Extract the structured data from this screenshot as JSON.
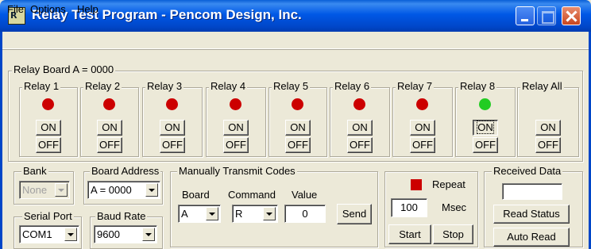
{
  "window": {
    "title": "Relay Test Program - Pencom Design, Inc.",
    "app_icon_text": "R"
  },
  "menu": [
    "File",
    "Options",
    "Help"
  ],
  "relay_board": {
    "title": "Relay Board A = 0000",
    "relays": [
      {
        "label": "Relay 1",
        "led_color": "#cc0000",
        "on": "ON",
        "off": "OFF"
      },
      {
        "label": "Relay 2",
        "led_color": "#cc0000",
        "on": "ON",
        "off": "OFF"
      },
      {
        "label": "Relay 3",
        "led_color": "#cc0000",
        "on": "ON",
        "off": "OFF"
      },
      {
        "label": "Relay 4",
        "led_color": "#cc0000",
        "on": "ON",
        "off": "OFF"
      },
      {
        "label": "Relay 5",
        "led_color": "#cc0000",
        "on": "ON",
        "off": "OFF"
      },
      {
        "label": "Relay 6",
        "led_color": "#cc0000",
        "on": "ON",
        "off": "OFF"
      },
      {
        "label": "Relay 7",
        "led_color": "#cc0000",
        "on": "ON",
        "off": "OFF"
      },
      {
        "label": "Relay 8",
        "led_color": "#22cc22",
        "on": "ON",
        "off": "OFF"
      }
    ],
    "relay_all": {
      "label": "Relay All",
      "on": "ON",
      "off": "OFF"
    }
  },
  "bank": {
    "label": "Bank",
    "value": "None"
  },
  "board_address": {
    "label": "Board Address",
    "value": "A = 0000"
  },
  "serial_port": {
    "label": "Serial Port",
    "value": "COM1"
  },
  "baud_rate": {
    "label": "Baud Rate",
    "value": "9600"
  },
  "manual": {
    "title": "Manually Transmit Codes",
    "board_label": "Board",
    "board_value": "A",
    "command_label": "Command",
    "command_value": "R",
    "value_label": "Value",
    "value_value": "0",
    "send": "Send"
  },
  "repeat": {
    "label": "Repeat",
    "indicator_color": "#cc0000",
    "interval": "100",
    "unit": "Msec",
    "start": "Start",
    "stop": "Stop"
  },
  "received": {
    "title": "Received Data",
    "value": "",
    "read_status": "Read Status",
    "auto_read": "Auto Read"
  }
}
